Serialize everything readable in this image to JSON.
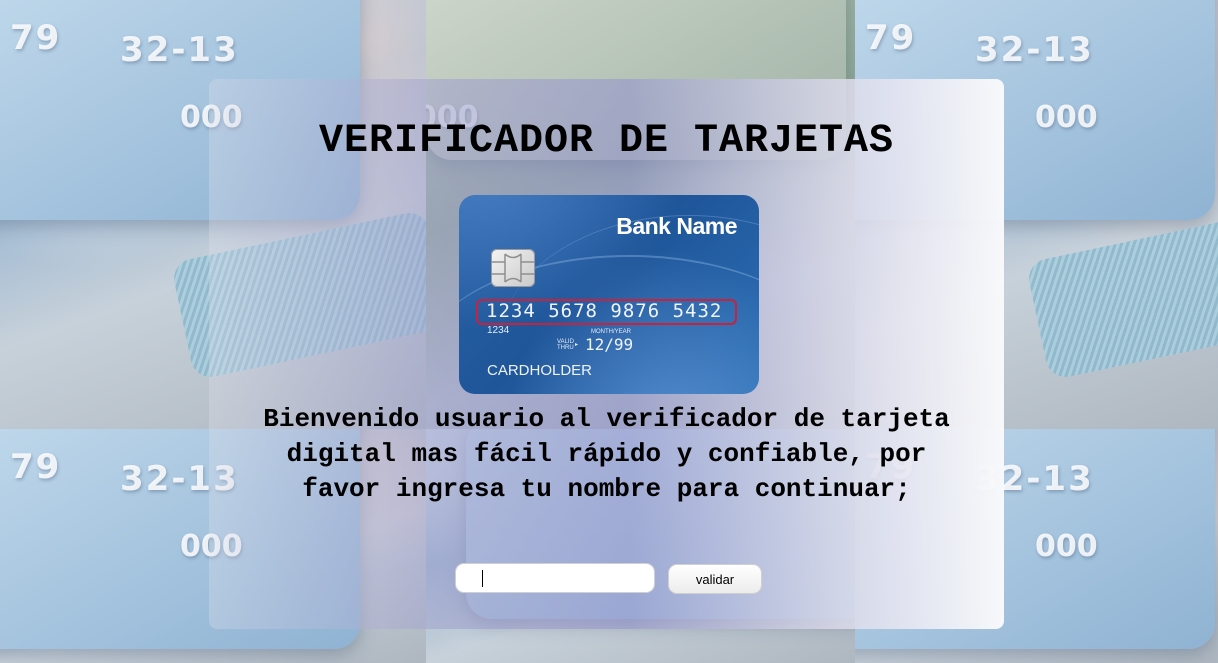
{
  "page": {
    "title": "VERIFICADOR DE TARJETAS",
    "welcome": "Bienvenido usuario al verificador de tarjeta digital mas fácil rápido y confiable, por favor ingresa tu nombre para continuar;"
  },
  "card": {
    "bank_name": "Bank Name",
    "number": "1234 5678 9876 5432",
    "small_number": "1234",
    "valid_label": "VALID THRU",
    "month_year_label": "MONTH/YEAR",
    "expiry": "12/99",
    "holder": "CARDHOLDER",
    "highlight_color": "#c8223c"
  },
  "form": {
    "name_value": "",
    "button_label": "validar"
  },
  "colors": {
    "card_blue": "#1f5599",
    "panel_tint": "#9696cd"
  }
}
